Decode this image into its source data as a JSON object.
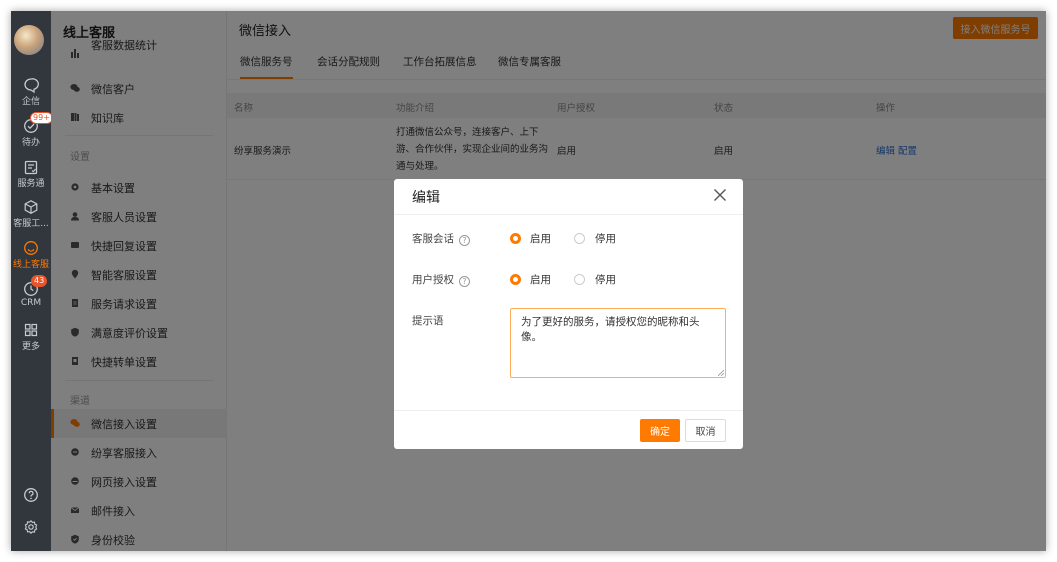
{
  "rail": {
    "items": [
      {
        "label": "企信",
        "icon": "chat-bubble-icon"
      },
      {
        "label": "待办",
        "icon": "check-circle-icon",
        "badge": "99+"
      },
      {
        "label": "服务通",
        "icon": "clipboard-icon"
      },
      {
        "label": "客服工...",
        "icon": "cube-icon"
      },
      {
        "label": "线上客服",
        "icon": "smile-icon",
        "active": true
      },
      {
        "label": "CRM",
        "icon": "clock-icon",
        "badge": "43"
      },
      {
        "label": "更多",
        "icon": "grid-icon"
      }
    ],
    "bottom_icons": [
      "help-icon",
      "settings-icon"
    ]
  },
  "sidebar": {
    "title": "线上客服",
    "items_top": [
      "客服数据统计",
      "微信客户",
      "知识库"
    ],
    "section_settings": "设置",
    "settings_items": [
      "基本设置",
      "客服人员设置",
      "快捷回复设置",
      "智能客服设置",
      "服务请求设置",
      "满意度评价设置",
      "快捷转单设置"
    ],
    "section_channels": "渠道",
    "channel_items": [
      "微信接入设置",
      "纷享客服接入",
      "网页接入设置",
      "邮件接入",
      "身份校验"
    ],
    "active_item": "微信接入设置"
  },
  "main": {
    "title": "微信接入",
    "primary_button": "接入微信服务号",
    "tabs": [
      "微信服务号",
      "会话分配规则",
      "工作台拓展信息",
      "微信专属客服"
    ],
    "active_tab": "微信服务号",
    "table": {
      "headers": [
        "名称",
        "功能介绍",
        "用户授权",
        "状态",
        "操作"
      ],
      "rows": [
        {
          "name": "纷享服务演示",
          "description": "打通微信公众号，连接客户、上下游、合作伙伴，实现企业间的业务沟通与处理。",
          "user_auth": "启用",
          "status": "启用",
          "actions": [
            "编辑",
            "配置"
          ]
        }
      ]
    }
  },
  "modal": {
    "title": "编辑",
    "fields": [
      {
        "label": "客服会话",
        "options": [
          "启用",
          "停用"
        ],
        "selected": "启用"
      },
      {
        "label": "用户授权",
        "options": [
          "启用",
          "停用"
        ],
        "selected": "启用"
      }
    ],
    "prompt_label": "提示语",
    "prompt_value": "为了更好的服务，请授权您的昵称和头像。",
    "ok_label": "确定",
    "cancel_label": "取消"
  },
  "colors": {
    "accent": "#ff7a00",
    "rail_bg": "#32363d",
    "link": "#2f6fd6",
    "badge": "#e8542b"
  }
}
